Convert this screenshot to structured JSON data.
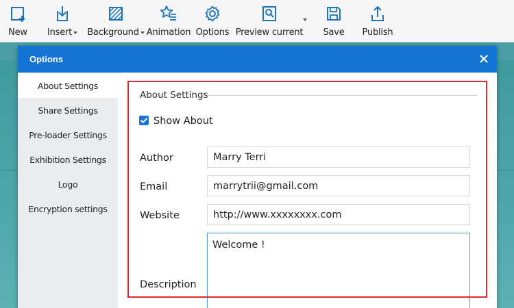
{
  "toolbar": {
    "items": [
      {
        "id": "new",
        "label": "New",
        "icon": "new-page-icon",
        "has_dropdown": false
      },
      {
        "id": "insert",
        "label": "Insert",
        "icon": "insert-download-icon",
        "has_dropdown": true
      },
      {
        "id": "background",
        "label": "Background",
        "icon": "background-pattern-icon",
        "has_dropdown": true
      },
      {
        "id": "animation",
        "label": "Animation",
        "icon": "animation-star-icon",
        "has_dropdown": false
      },
      {
        "id": "options",
        "label": "Options",
        "icon": "gear-icon",
        "has_dropdown": false
      },
      {
        "id": "preview",
        "label": "Preview current",
        "icon": "preview-magnifier-icon",
        "has_dropdown": true
      },
      {
        "id": "save",
        "label": "Save",
        "icon": "floppy-disk-icon",
        "has_dropdown": false
      },
      {
        "id": "publish",
        "label": "Publish",
        "icon": "upload-icon",
        "has_dropdown": false
      }
    ],
    "icon_color": "#1e73b8"
  },
  "dialog": {
    "title": "Options",
    "close_icon": "close-icon",
    "header_color": "#1474d4",
    "sidebar": {
      "items": [
        {
          "label": "About Settings",
          "active": true
        },
        {
          "label": "Share Settings",
          "active": false
        },
        {
          "label": "Pre-loader Settings",
          "active": false
        },
        {
          "label": "Exhibition Settings",
          "active": false
        },
        {
          "label": "Logo",
          "active": false
        },
        {
          "label": "Encryption settings",
          "active": false
        }
      ]
    },
    "content": {
      "section_title": "About Settings",
      "show_about": {
        "label": "Show About",
        "checked": true
      },
      "fields": {
        "author": {
          "label": "Author",
          "value": "Marry Terri"
        },
        "email": {
          "label": "Email",
          "value": "marrytrii@gmail.com"
        },
        "website": {
          "label": "Website",
          "value": "http://www.xxxxxxxx.com"
        },
        "description": {
          "label": "Description",
          "value": "Welcome !"
        }
      }
    }
  },
  "highlight_color": "#e8262f"
}
